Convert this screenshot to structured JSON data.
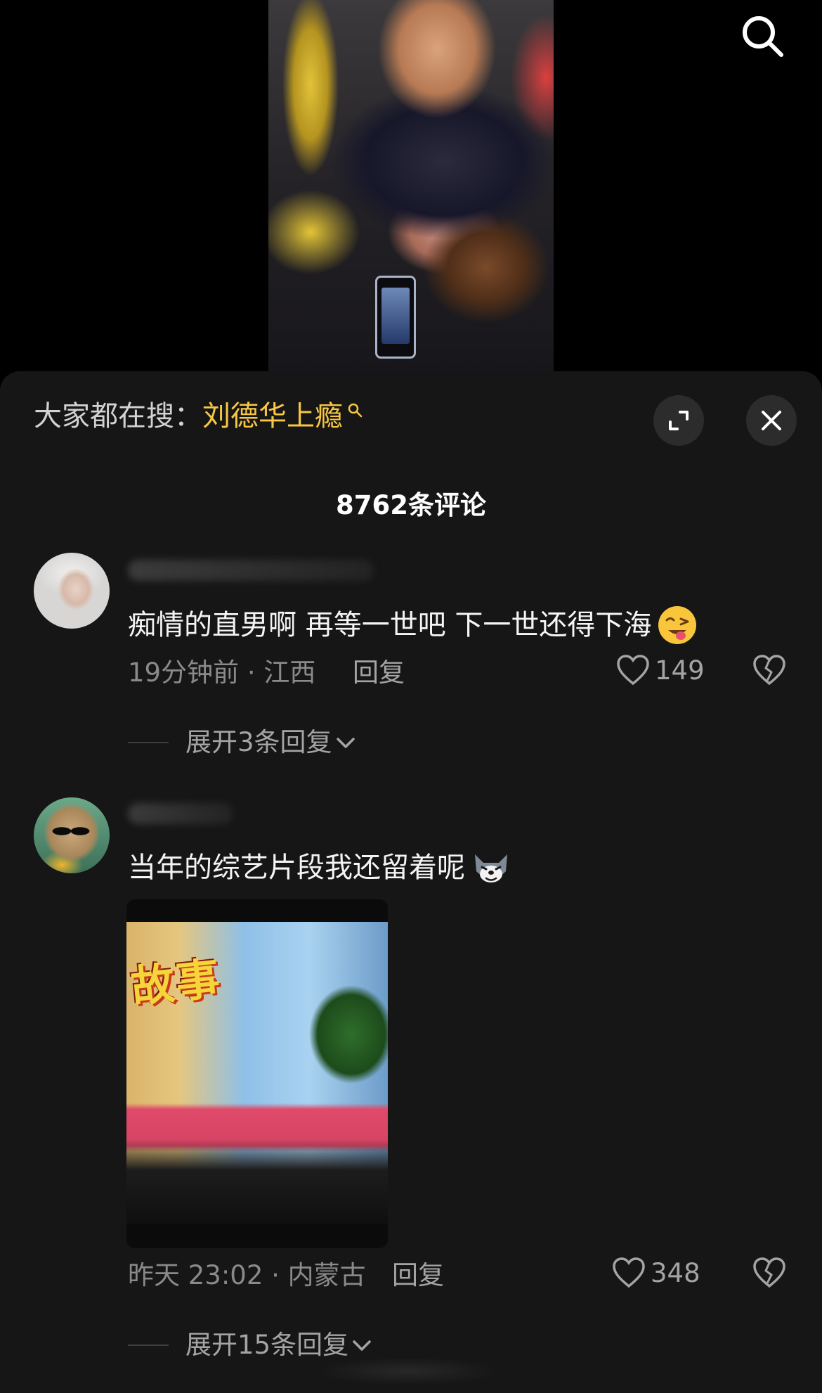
{
  "sheet": {
    "trending_prefix": "大家都在搜：",
    "trending_term": "刘德华上瘾",
    "comment_count": "8762条评论"
  },
  "comments": [
    {
      "text": "痴情的直男啊 再等一世吧 下一世还得下海",
      "emoji": "wink-tongue-emoji",
      "time_location": "19分钟前 · 江西",
      "reply_label": "回复",
      "likes": "149",
      "expand_label": "展开3条回复"
    },
    {
      "text": "当年的综艺片段我还留着呢",
      "emoji": "husky-emoji",
      "media_caption": "故事",
      "time_location": "昨天 23:02 · 内蒙古",
      "reply_label": "回复",
      "likes": "348",
      "expand_label": "展开15条回复"
    }
  ],
  "colors": {
    "sheet_bg": "#161616",
    "trending_term": "#f7c844",
    "meta_text": "#8a8a8a"
  }
}
